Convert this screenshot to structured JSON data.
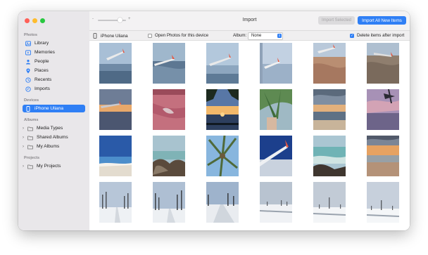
{
  "window": {
    "title": "Import"
  },
  "sidebar": {
    "photos_header": "Photos",
    "photos_items": [
      {
        "label": "Library",
        "icon": "photo-library-icon"
      },
      {
        "label": "Memories",
        "icon": "memories-icon"
      },
      {
        "label": "People",
        "icon": "people-icon"
      },
      {
        "label": "Places",
        "icon": "places-pin-icon"
      },
      {
        "label": "Recents",
        "icon": "recents-clock-icon"
      },
      {
        "label": "Imports",
        "icon": "imports-clock-icon"
      }
    ],
    "devices_header": "Devices",
    "device_item": {
      "label": "iPhone Uliana",
      "icon": "iphone-icon",
      "selected": true
    },
    "albums_header": "Albums",
    "albums_items": [
      {
        "label": "Media Types",
        "icon": "folder-icon"
      },
      {
        "label": "Shared Albums",
        "icon": "folder-icon"
      },
      {
        "label": "My Albums",
        "icon": "folder-icon"
      }
    ],
    "projects_header": "Projects",
    "projects_items": [
      {
        "label": "My Projects",
        "icon": "folder-icon"
      }
    ]
  },
  "titlebar": {
    "zoom_minus": "-",
    "zoom_plus": "+",
    "import_selected_label": "Import Selected",
    "import_all_label": "Import All New Items"
  },
  "toolbar": {
    "device_label": "iPhone Uliana",
    "open_photos_label": "Open Photos for this device",
    "open_photos_checked": false,
    "album_label": "Album:",
    "album_value": "None",
    "delete_label": "Delete items after import",
    "delete_checked": true
  },
  "photos": [
    "airplane-wing-sky",
    "airplane-wing-ocean",
    "airplane-wing-sky",
    "airplane-window-sky",
    "airplane-wing-desert",
    "airplane-wing-desert",
    "airplane-wing-sunset",
    "pink-aerial-lake",
    "palm-sunset-silhouette",
    "palm-leaves-hand",
    "beach-sunset-clouds",
    "purple-sky-palm",
    "blue-sky-beach",
    "beach-rocks-sky",
    "palm-tree-from-below",
    "airplane-wing-blue-sky",
    "sea-waves-rocks",
    "sunset-beach-waves",
    "snowy-trees-road",
    "snowy-trees-road",
    "snowy-path-trees",
    "snowy-field-trees",
    "snowy-field-sky",
    "snowy-field-bush"
  ],
  "colors": {
    "accent": "#2f7ff5",
    "sidebar_bg": "#e9e7ea",
    "close": "#ff5f57",
    "minimize": "#febc2e",
    "maximize": "#28c840"
  }
}
